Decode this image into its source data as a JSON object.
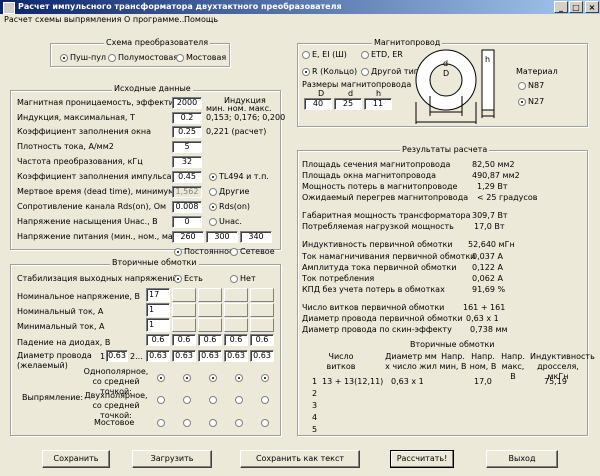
{
  "window": {
    "title": "Расчет импульсного трансформатора двухтактного преобразователя",
    "min": "_",
    "max": "□",
    "close": "×"
  },
  "menu": [
    "Расчет схемы выпрямления",
    "О программе...",
    "Помощь"
  ],
  "topology": {
    "title": "Схема преобразователя",
    "options": [
      "Пуш-пул",
      "Полумостовая",
      "Мостовая"
    ],
    "selected": 0
  },
  "input": {
    "title": "Исходные данные",
    "induction_header": "Индукция",
    "induction_sub": "мин. ном. макс.",
    "permeability": {
      "label": "Магнитная проницаемость, эффективная",
      "value": "2000",
      "note": "0,153; 0,176; 0,200"
    },
    "induction": {
      "label": "Индукция, максимальная, Т",
      "value": "0.2"
    },
    "window_fill": {
      "label": "Коэффициент заполнения окна",
      "value": "0.25",
      "note": "0,221 (расчет)"
    },
    "current_density": {
      "label": "Плотность тока, А/мм2",
      "value": "5"
    },
    "frequency": {
      "label": "Частота преобразования, кГц",
      "value": "32"
    },
    "duty": {
      "label": "Коэффициент заполнения импульса, макс.",
      "value": "0.45",
      "opt1": "TL494 и т.п.",
      "opt2": "Другие"
    },
    "dead_time": {
      "label": "Мертвое время (dead time), минимум, мкс",
      "value": "1,562"
    },
    "rds": {
      "label": "Сопротивление канала Rds(on), Ом",
      "value": "0.008",
      "opt": "Rds(on)"
    },
    "usat": {
      "label": "Напряжение насыщения Uнас., В",
      "value": "0",
      "opt": "Uнас."
    },
    "supply": {
      "label": "Напряжение питания (мин., ном., макс.),",
      "min": "260",
      "nom": "300",
      "max": "340",
      "opt1": "Постоянное",
      "opt2": "Сетевое"
    }
  },
  "secondary": {
    "title": "Вторичные обмотки",
    "stab": {
      "label": "Стабилизация выходных напряжений",
      "yes": "Есть",
      "no": "Нет"
    },
    "nominal_voltage": {
      "label": "Номинальное напряжение, В",
      "values": [
        "17",
        "",
        "",
        "",
        ""
      ]
    },
    "nominal_current": {
      "label": "Номинальный ток, А",
      "values": [
        "1",
        "",
        "",
        "",
        ""
      ]
    },
    "min_current": {
      "label": "Минимальный ток, А",
      "values": [
        "1",
        "",
        "",
        "",
        ""
      ]
    },
    "diode_drop": {
      "label": "Падение на диодах, В",
      "values": [
        "0.6",
        "0.6",
        "0.6",
        "0.6",
        "0.6"
      ]
    },
    "wire": {
      "label": "Диаметр провода (желаемый)",
      "n1": "1",
      "v1": "0.63",
      "n2": "2...",
      "values": [
        "0.63",
        "0.63",
        "0.63",
        "0.63",
        "0.63"
      ]
    },
    "rect_label": "Выпрямление:",
    "rect1": "Однополярное, со средней точкой:",
    "rect2": "Двухполярное, со средней точкой:",
    "rect3": "Мостовое"
  },
  "core": {
    "title": "Магнитопровод",
    "types": [
      "E, EI (Ш)",
      "ETD, ER",
      "R (Кольцо)",
      "Другой тип"
    ],
    "selected": 2,
    "size_label": "Размеры магнитопровода",
    "dims": [
      "D",
      "d",
      "h"
    ],
    "dim_values": [
      "40",
      "25",
      "11"
    ],
    "material_title": "Материал",
    "materials": [
      "N87",
      "N27"
    ],
    "material_selected": 1,
    "draw_labels": {
      "d": "d",
      "D": "D",
      "h": "h"
    }
  },
  "results": {
    "title": "Результаты расчета",
    "rows": [
      {
        "label": "Площадь сечения магнитопровода",
        "value": "82,50 мм2"
      },
      {
        "label": "Площадь окна магнитопровода",
        "value": "490,87 мм2"
      },
      {
        "label": "Мощность потерь в магнитопроводе",
        "value": "1,29 Вт"
      },
      {
        "label": "Ожидаемый перегрев магнитопровода",
        "value": "< 25 градусов"
      },
      {
        "label": "Габаритная мощность трансформатора",
        "value": "309,7 Вт"
      },
      {
        "label": "Потребляемая нагрузкой мощность",
        "value": "17,0 Вт"
      },
      {
        "label": "Индуктивность первичной обмотки",
        "value": "52,640 мГн"
      },
      {
        "label": "Ток намагничивания первичной обмотки",
        "value": "0,037 А"
      },
      {
        "label": "Амплитуда тока первичной обмотки",
        "value": "0,122 А"
      },
      {
        "label": "Ток потребления",
        "value": "0,062 А"
      },
      {
        "label": "КПД без учета потерь в обмотках",
        "value": "91,69 %"
      },
      {
        "label": "Число витков первичной обмотки",
        "value": "161 + 161"
      },
      {
        "label": "Диаметр провода первичной обмотки",
        "value": "0,63 x 1"
      },
      {
        "label": "Диаметр провода по скин-эффекту",
        "value": "0,738 мм"
      }
    ],
    "sec_title": "Вторичные обмотки",
    "headers": [
      "Число витков",
      "Диаметр мм x число жил",
      "Напр. мин, В",
      "Напр. ном, В",
      "Напр. макс, В",
      "Индуктивность дросселя, мкГн"
    ],
    "rows2": [
      {
        "n": "1",
        "turns": "13 + 13(12,11)",
        "diam": "0,63 x 1",
        "umin": "",
        "unom": "17,0",
        "umax": "",
        "ind": "75,19"
      },
      {
        "n": "2",
        "turns": "",
        "diam": "",
        "umin": "",
        "unom": "",
        "umax": "",
        "ind": ""
      },
      {
        "n": "3",
        "turns": "",
        "diam": "",
        "umin": "",
        "unom": "",
        "umax": "",
        "ind": ""
      },
      {
        "n": "4",
        "turns": "",
        "diam": "",
        "umin": "",
        "unom": "",
        "umax": "",
        "ind": ""
      },
      {
        "n": "5",
        "turns": "",
        "diam": "",
        "umin": "",
        "unom": "",
        "umax": "",
        "ind": ""
      }
    ]
  },
  "buttons": {
    "save": "Сохранить",
    "load": "Загрузить",
    "save_text": "Сохранить как текст",
    "calc": "Рассчитать!",
    "exit": "Выход"
  }
}
